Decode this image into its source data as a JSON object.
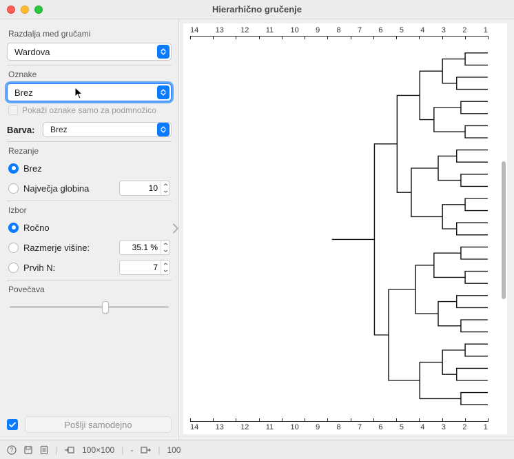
{
  "window": {
    "title": "Hierarhično gručenje"
  },
  "linkage": {
    "label": "Razdalja med gručami",
    "value": "Wardova"
  },
  "annotations": {
    "label": "Oznake",
    "value": "Brez",
    "subset_checkbox_label": "Pokaži oznake samo za podmnožico",
    "color_label": "Barva:",
    "color_value": "Brez"
  },
  "pruning": {
    "label": "Rezanje",
    "options": {
      "none": "Brez",
      "maxdepth": "Največja globina"
    },
    "selected": "none",
    "maxdepth_value": "10"
  },
  "selection": {
    "label": "Izbor",
    "options": {
      "manual": "Ročno",
      "ratio": "Razmerje višine:",
      "topn": "Prvih N:"
    },
    "selected": "manual",
    "ratio_value": "35.1 %",
    "topn_value": "7"
  },
  "zoom": {
    "label": "Povečava"
  },
  "auto_send": {
    "label": "Pošlji samodejno",
    "checked": true
  },
  "status": {
    "in_summary": "100×100",
    "in_extra": "-",
    "out_summary": "100"
  },
  "axis_ticks": [
    "14",
    "13",
    "12",
    "11",
    "10",
    "9",
    "8",
    "7",
    "6",
    "5",
    "4",
    "3",
    "2",
    "1"
  ]
}
